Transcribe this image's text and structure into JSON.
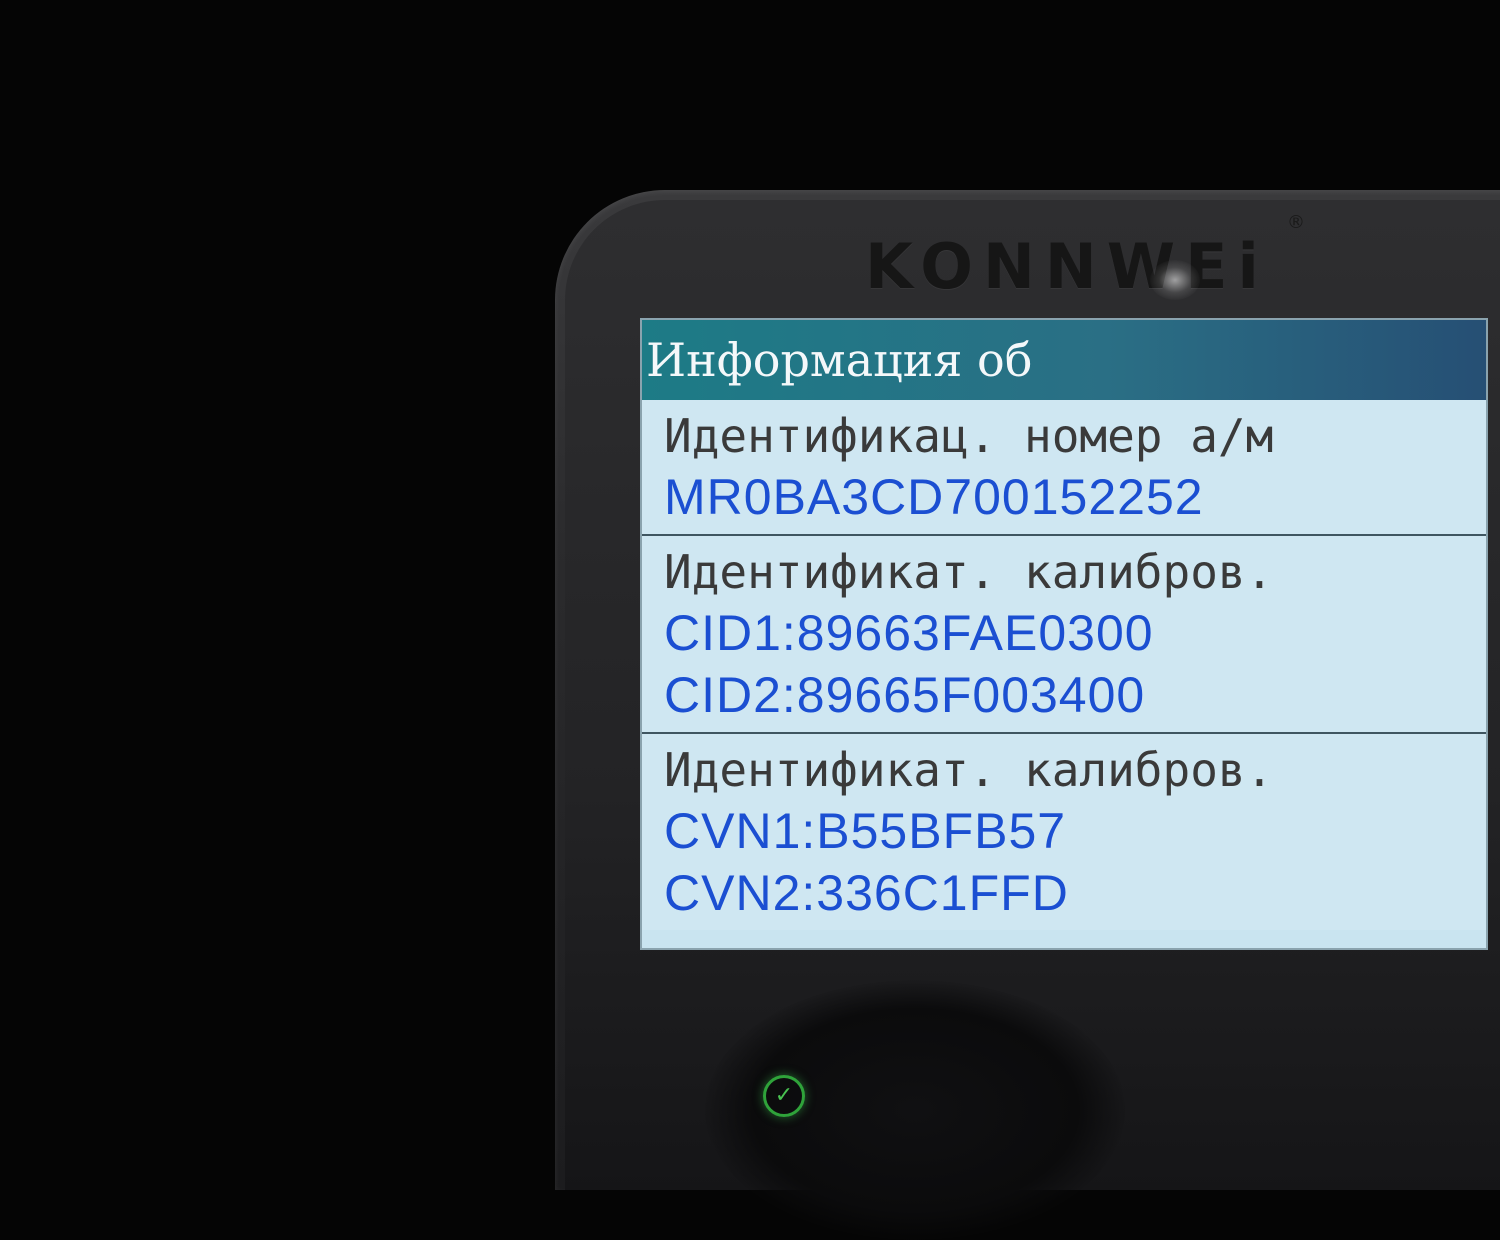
{
  "device": {
    "brand": "KONNWEi",
    "registered_mark": "®",
    "status_icon": "check-icon",
    "status_color": "#2fa33a"
  },
  "screen": {
    "title": "Информация об",
    "sections": [
      {
        "label": "Идентификац. номер а/м",
        "values": [
          "MR0BA3CD700152252"
        ]
      },
      {
        "label": "Идентификат. калибров.",
        "values": [
          "CID1:89663FAE0300",
          "CID2:89665F003400"
        ]
      },
      {
        "label": "Идентификат. калибров.",
        "values": [
          "CVN1:B55BFB57",
          "CVN2:336C1FFD"
        ]
      }
    ]
  },
  "colors": {
    "title_bar": "#1d7b86",
    "screen_bg": "#c9e4f0",
    "value_text": "#1b4fd2",
    "label_text": "#3a3a3a"
  }
}
